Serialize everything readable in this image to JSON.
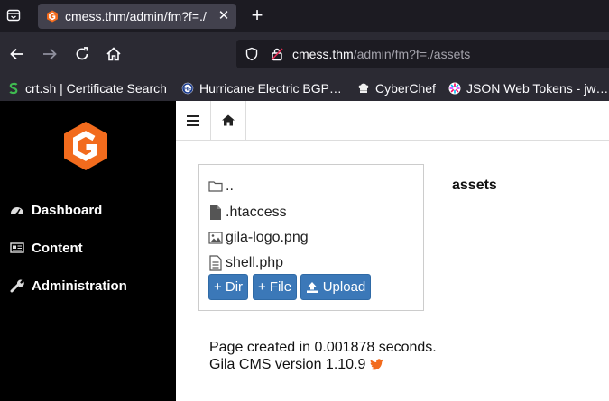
{
  "browser": {
    "tab": {
      "title": "cmess.thm/admin/fm?f=./",
      "close": "✕"
    },
    "new_tab": "+",
    "url": {
      "host": "cmess.thm",
      "path": "/admin/fm?f=./assets"
    },
    "bookmarks": [
      {
        "label": "crt.sh | Certificate Search",
        "icon": "crtsh-icon"
      },
      {
        "label": "Hurricane Electric BGP…",
        "icon": "he-bgp-icon"
      },
      {
        "label": "CyberChef",
        "icon": "cyberchef-icon"
      },
      {
        "label": "JSON Web Tokens - jw…",
        "icon": "jwt-icon"
      }
    ]
  },
  "sidebar": {
    "items": [
      {
        "label": "Dashboard",
        "icon": "dashboard-icon"
      },
      {
        "label": "Content",
        "icon": "newspaper-icon"
      },
      {
        "label": "Administration",
        "icon": "wrench-icon"
      }
    ]
  },
  "topbar": {
    "menu_icon": "hamburger-icon",
    "home_icon": "home-icon"
  },
  "file_manager": {
    "items": [
      {
        "name": "..",
        "icon": "folder-icon"
      },
      {
        "name": ".htaccess",
        "icon": "file-icon"
      },
      {
        "name": "gila-logo.png",
        "icon": "image-file-icon"
      },
      {
        "name": "shell.php",
        "icon": "text-file-icon"
      }
    ],
    "buttons": {
      "dir": "+ Dir",
      "file": "+ File",
      "upload": "Upload"
    },
    "folder_title": "assets"
  },
  "footer": {
    "line1": "Page created in 0.001878 seconds.",
    "line2": "Gila CMS version 1.10.9"
  },
  "colors": {
    "accent": "#f26b1d",
    "button": "#3b78b8",
    "sidebar": "#000000",
    "chrome": "#2b2a33"
  }
}
